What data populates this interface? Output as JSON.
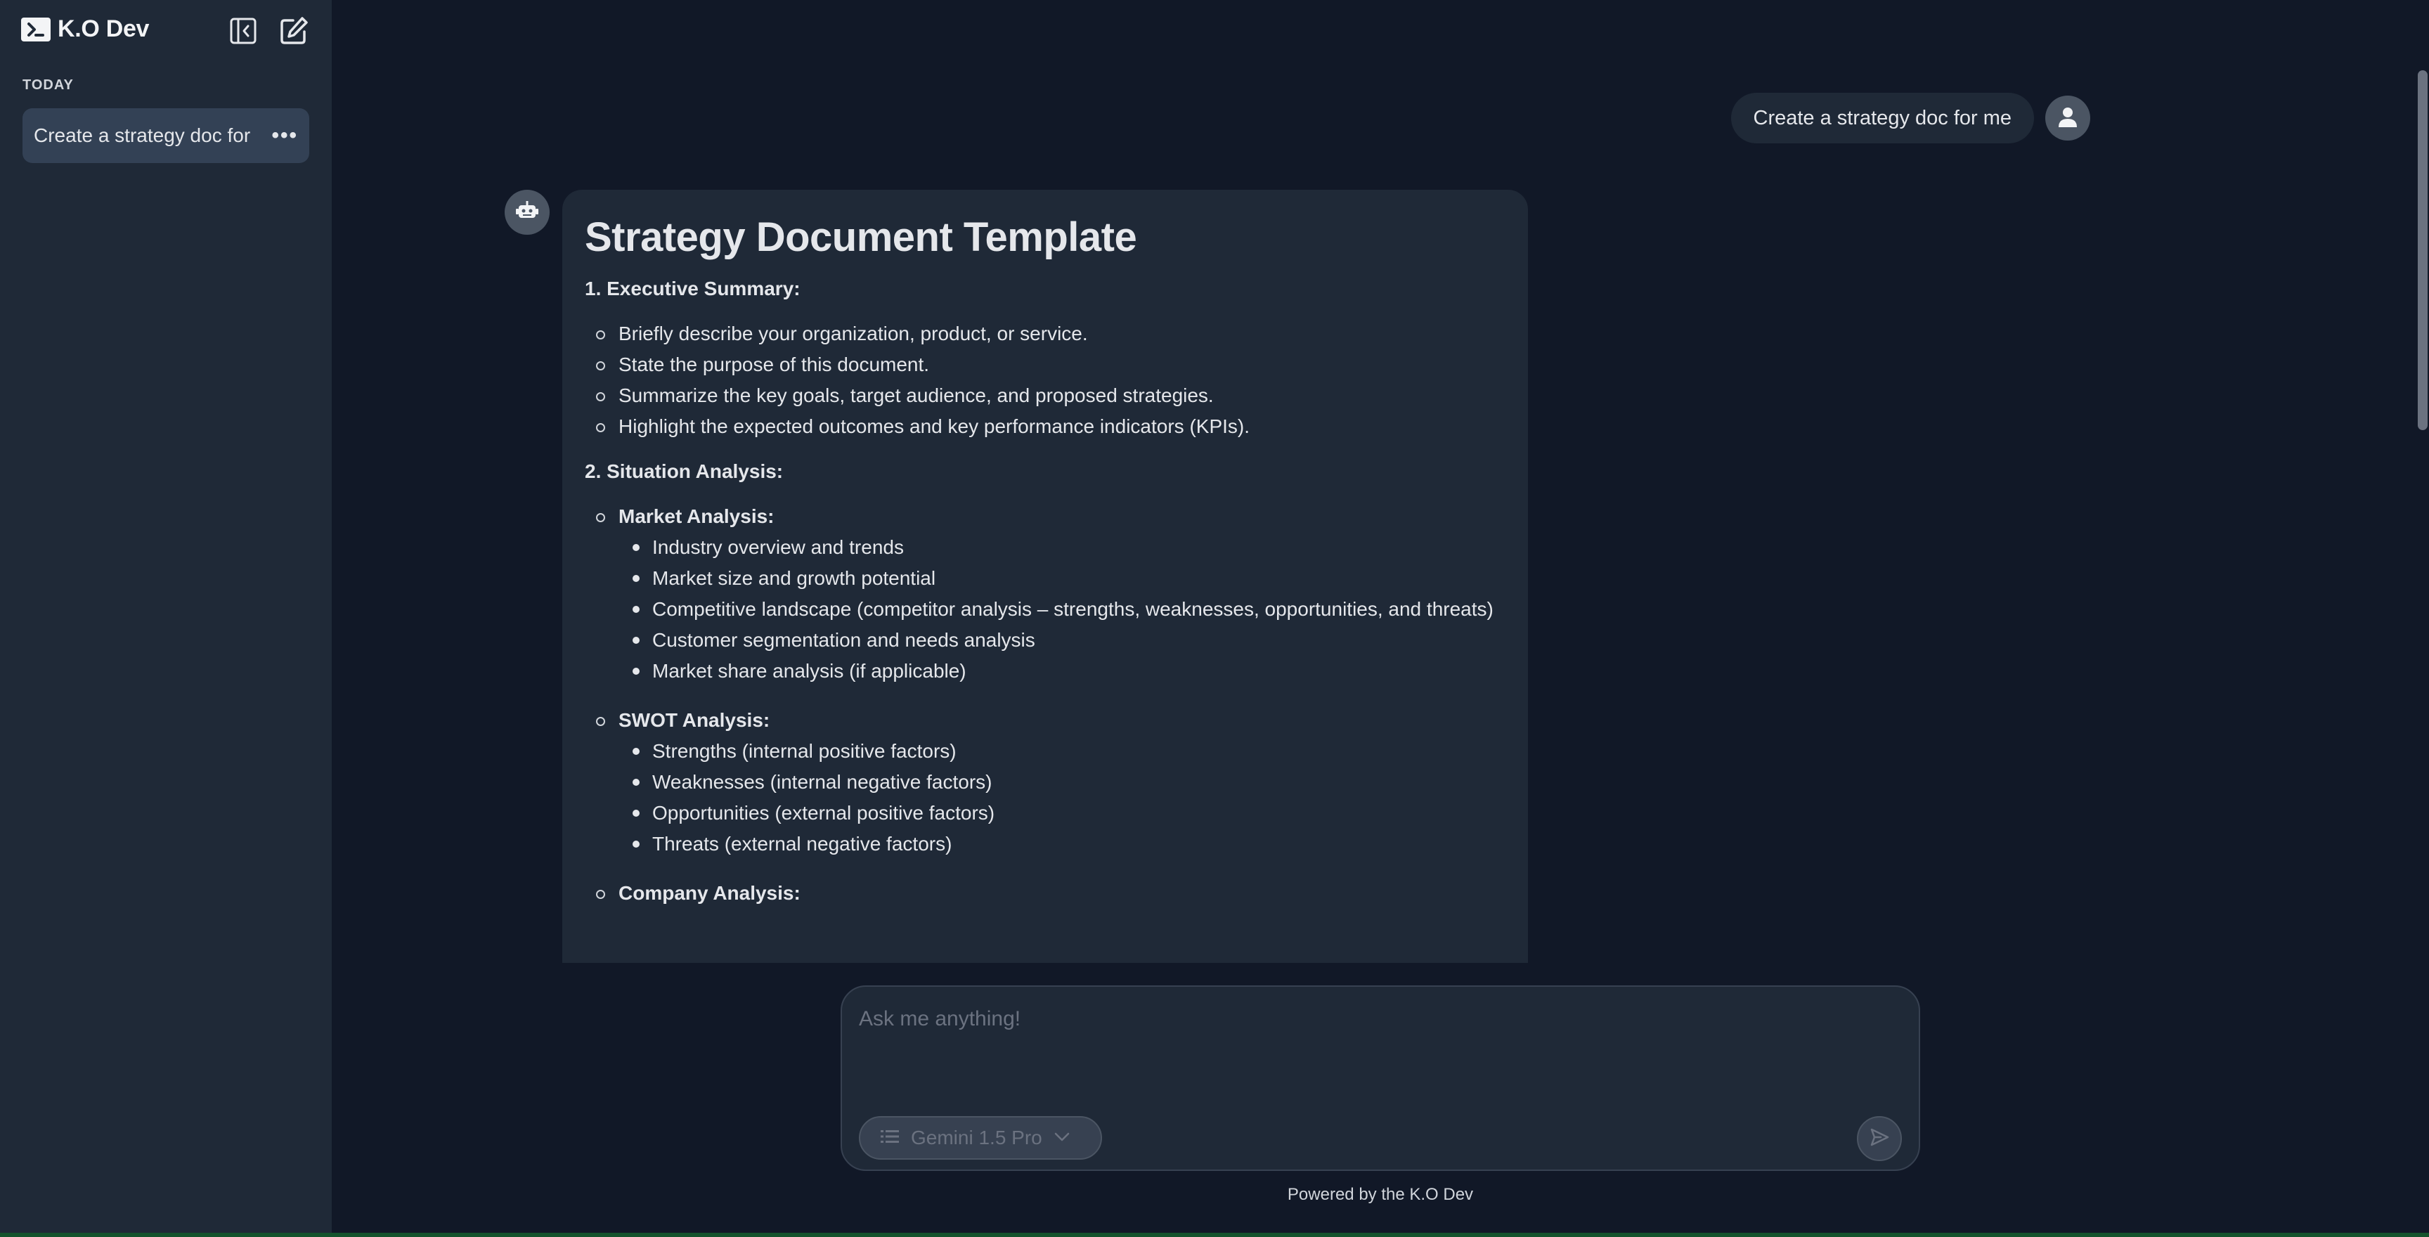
{
  "sidebar": {
    "brand_name": "K.O Dev",
    "section_label": "TODAY",
    "chat_items": [
      {
        "label": "Create a strategy doc for",
        "more": "•••"
      }
    ],
    "icons": {
      "brand": "terminal-icon",
      "collapse": "sidebar-collapse-icon",
      "new_chat": "edit-icon"
    }
  },
  "conversation": {
    "user_message": "Create a strategy doc for me",
    "response": {
      "title": "Strategy Document Template",
      "sections": [
        {
          "heading": "1. Executive Summary:",
          "bullets": [
            "Briefly describe your organization, product, or service.",
            "State the purpose of this document.",
            "Summarize the key goals, target audience, and proposed strategies.",
            "Highlight the expected outcomes and key performance indicators (KPIs)."
          ]
        },
        {
          "heading": "2. Situation Analysis:",
          "groups": [
            {
              "heading": "Market Analysis:",
              "items": [
                "Industry overview and trends",
                "Market size and growth potential",
                "Competitive landscape (competitor analysis – strengths, weaknesses, opportunities, and threats)",
                "Customer segmentation and needs analysis",
                "Market share analysis (if applicable)"
              ]
            },
            {
              "heading": "SWOT Analysis:",
              "items": [
                "Strengths (internal positive factors)",
                "Weaknesses (internal negative factors)",
                "Opportunities (external positive factors)",
                "Threats (external negative factors)"
              ]
            },
            {
              "heading": "Company Analysis:"
            }
          ]
        }
      ]
    }
  },
  "composer": {
    "placeholder": "Ask me anything!",
    "model_label": "Gemini 1.5 Pro",
    "icons": {
      "model": "list-icon",
      "dropdown": "chevron-down-icon",
      "send": "send-icon"
    }
  },
  "footer": {
    "note": "Powered by the K.O Dev"
  },
  "colors": {
    "background": "#111827",
    "sidebar": "#1f2937",
    "selected_chat": "#334155",
    "bubble": "#1f2937",
    "text": "#e5e7eb",
    "muted": "#6b7280"
  }
}
